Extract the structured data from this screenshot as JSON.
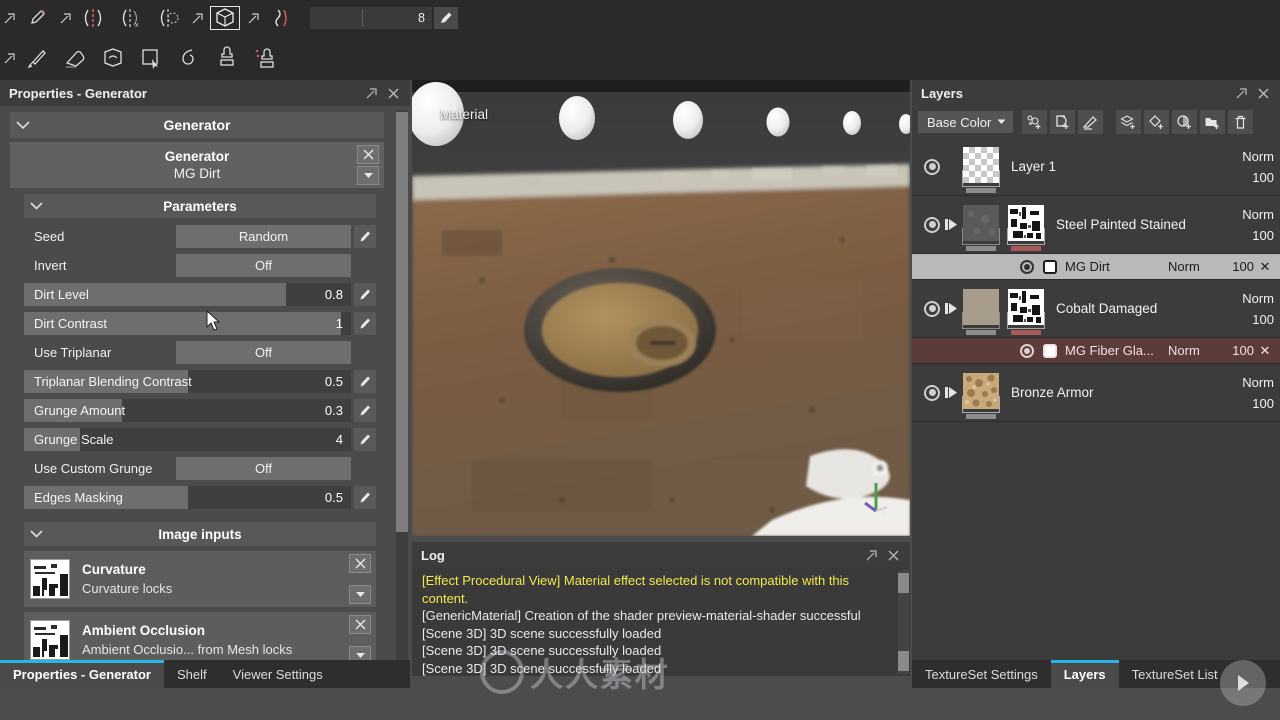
{
  "toolbar": {
    "value_field": "8",
    "tools_row1": [
      {
        "name": "eyedropper-icon",
        "label": "Material Picker"
      },
      {
        "name": "symmetry-toggle-icon",
        "label": "Symmetry"
      },
      {
        "name": "symmetry-axis-x-icon",
        "label": "Symmetry Axis"
      },
      {
        "name": "symmetry-rotation-icon",
        "label": "Radial Symmetry"
      },
      {
        "name": "cube-projection-icon",
        "label": "3D View",
        "active": true
      },
      {
        "name": "mirror-curve-icon",
        "label": "Mirror"
      }
    ],
    "tools_row2": [
      {
        "name": "paint-brush-icon",
        "label": "Paint"
      },
      {
        "name": "eraser-icon",
        "label": "Eraser"
      },
      {
        "name": "projection-icon",
        "label": "Projection"
      },
      {
        "name": "geometry-decal-icon",
        "label": "Geometry Decal"
      },
      {
        "name": "smudge-icon",
        "label": "Smudge"
      },
      {
        "name": "clone-stamp-icon",
        "label": "Clone"
      },
      {
        "name": "clone-stamp-pins-icon",
        "label": "Clone Pins"
      }
    ]
  },
  "properties": {
    "title": "Properties - Generator",
    "section_generator": "Generator",
    "generator_card": {
      "title": "Generator",
      "value": "MG Dirt"
    },
    "section_parameters": "Parameters",
    "parameters": [
      {
        "label": "Seed",
        "type": "combo",
        "value": "Random",
        "pencil": true
      },
      {
        "label": "Invert",
        "type": "combo",
        "value": "Off",
        "pencil": false
      },
      {
        "label": "Dirt Level",
        "type": "slider",
        "value": "0.8",
        "fill": 80,
        "pencil": true
      },
      {
        "label": "Dirt Contrast",
        "type": "slider",
        "value": "1",
        "fill": 97,
        "pencil": true
      },
      {
        "label": "Use Triplanar",
        "type": "combo",
        "value": "Off",
        "pencil": false
      },
      {
        "label": "Triplanar Blending Contrast",
        "type": "slider",
        "value": "0.5",
        "fill": 50,
        "pencil": true
      },
      {
        "label": "Grunge Amount",
        "type": "slider",
        "value": "0.3",
        "fill": 30,
        "pencil": true
      },
      {
        "label": "Grunge Scale",
        "type": "slider",
        "value": "4",
        "fill": 17,
        "pencil": true
      },
      {
        "label": "Use Custom Grunge",
        "type": "combo",
        "value": "Off",
        "pencil": false
      },
      {
        "label": "Edges Masking",
        "type": "slider",
        "value": "0.5",
        "fill": 50,
        "pencil": true
      }
    ],
    "section_image_inputs": "Image inputs",
    "image_inputs": [
      {
        "name": "Curvature",
        "source": "Curvature locks"
      },
      {
        "name": "Ambient Occlusion",
        "source": "Ambient Occlusio... from Mesh locks"
      }
    ]
  },
  "viewport": {
    "label": "Material"
  },
  "log": {
    "title": "Log",
    "lines": [
      {
        "text": "[Effect Procedural View] Material effect selected is not compatible with this content.",
        "warn": true
      },
      {
        "text": "[GenericMaterial] Creation of the shader preview-material-shader successful",
        "warn": false
      },
      {
        "text": "[Scene 3D] 3D scene successfully loaded",
        "warn": false
      },
      {
        "text": "[Scene 3D] 3D scene successfully loaded",
        "warn": false
      },
      {
        "text": "[Scene 3D] 3D scene successfully loaded",
        "warn": false
      }
    ]
  },
  "layers": {
    "title": "Layers",
    "channel": "Base Color",
    "tool_buttons": [
      {
        "name": "add-effect-icon",
        "label": "Add effect"
      },
      {
        "name": "add-mask-icon",
        "label": "Add black mask"
      },
      {
        "name": "add-paint-icon",
        "label": "Add paint"
      },
      {
        "name": "add-layer-icon",
        "label": "Add fill layer"
      },
      {
        "name": "add-fill-icon",
        "label": "Add fill"
      },
      {
        "name": "add-adjustment-icon",
        "label": "Add adjustment"
      },
      {
        "name": "add-folder-icon",
        "label": "Add folder"
      },
      {
        "name": "delete-layer-icon",
        "label": "Delete layer"
      }
    ],
    "rows": [
      {
        "kind": "layer",
        "name": "Layer 1",
        "blend": "Norm",
        "opacity": "100",
        "thumb": "checker",
        "group": false,
        "underbar": "gray"
      },
      {
        "kind": "layer",
        "name": "Steel Painted Stained",
        "blend": "Norm",
        "opacity": "100",
        "thumb": "noise",
        "group": true,
        "underbar": "red"
      },
      {
        "kind": "effect",
        "name": "MG Dirt",
        "blend": "Norm",
        "opacity": "100",
        "selected": true
      },
      {
        "kind": "layer",
        "name": "Cobalt Damaged",
        "blend": "Norm",
        "opacity": "100",
        "thumb": "noise",
        "group": true,
        "underbar": "red"
      },
      {
        "kind": "effect",
        "name": "MG Fiber Gla...",
        "blend": "Norm",
        "opacity": "100",
        "red": true
      },
      {
        "kind": "layer",
        "name": "Bronze Armor",
        "blend": "Norm",
        "opacity": "100",
        "thumb": "bronze",
        "group": true,
        "underbar": "gray"
      }
    ]
  },
  "bottom_tabs": {
    "left": [
      {
        "label": "Properties - Generator",
        "active": true
      },
      {
        "label": "Shelf",
        "active": false
      },
      {
        "label": "Viewer Settings",
        "active": false
      }
    ],
    "right": [
      {
        "label": "TextureSet Settings",
        "active": false
      },
      {
        "label": "Layers",
        "active": true
      },
      {
        "label": "TextureSet List",
        "active": false
      }
    ]
  },
  "watermark": {
    "text": "人人素材"
  },
  "colors": {
    "accent": "#28b4e8",
    "warn": "#f2e84c",
    "panel": "#3c3c3c"
  }
}
